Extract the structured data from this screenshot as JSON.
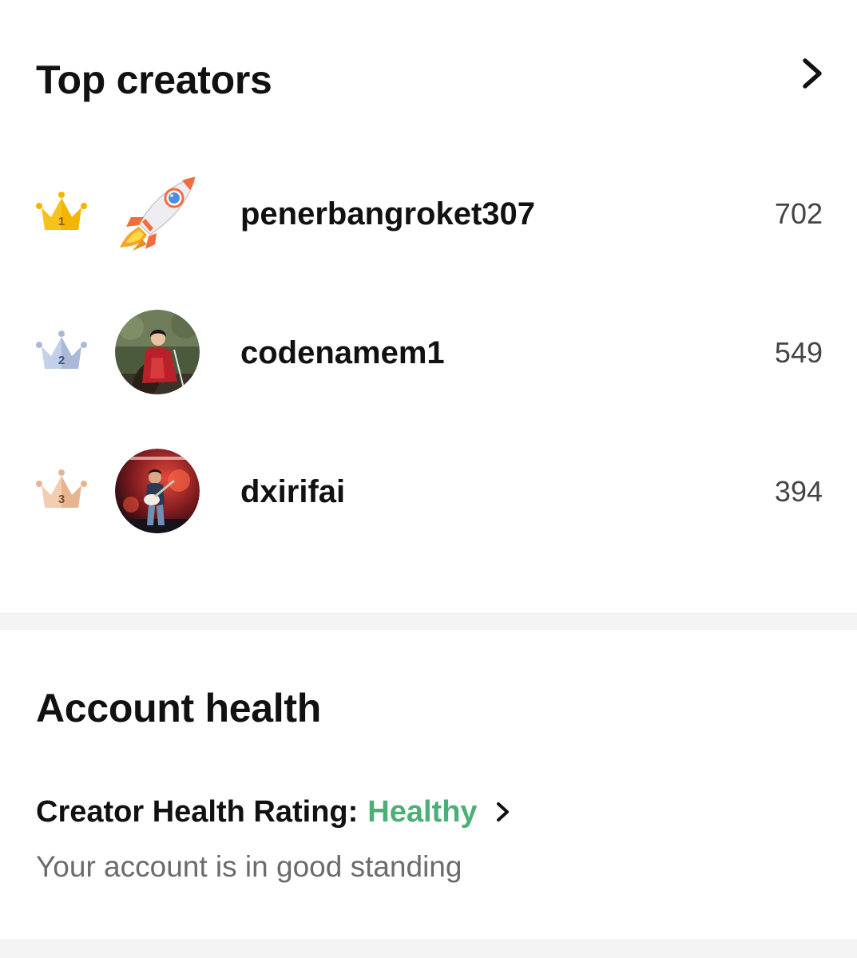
{
  "top_creators": {
    "title": "Top creators",
    "creators": [
      {
        "rank": "1",
        "username": "penerbangroket307",
        "count": "702",
        "avatar": "rocket-emoji"
      },
      {
        "rank": "2",
        "username": "codenamem1",
        "count": "549",
        "avatar": "photo-person-red-robe-on-horse"
      },
      {
        "rank": "3",
        "username": "dxirifai",
        "count": "394",
        "avatar": "photo-guitarist-on-stage"
      }
    ]
  },
  "account_health": {
    "title": "Account health",
    "rating_label": "Creator Health Rating:",
    "rating_value": "Healthy",
    "rating_subtitle": "Your account is in good standing"
  },
  "colors": {
    "healthy": "#4caf78",
    "gold_crown": "#f7c21e",
    "silver_crown": "#b3c4e0",
    "bronze_crown": "#eebfa0",
    "divider": "#f4f4f4"
  },
  "icons": {
    "header_more": "chevron-right-icon",
    "rating_more": "chevron-right-icon",
    "rank_badges": [
      "gold-crown-icon",
      "silver-crown-icon",
      "bronze-crown-icon"
    ]
  }
}
